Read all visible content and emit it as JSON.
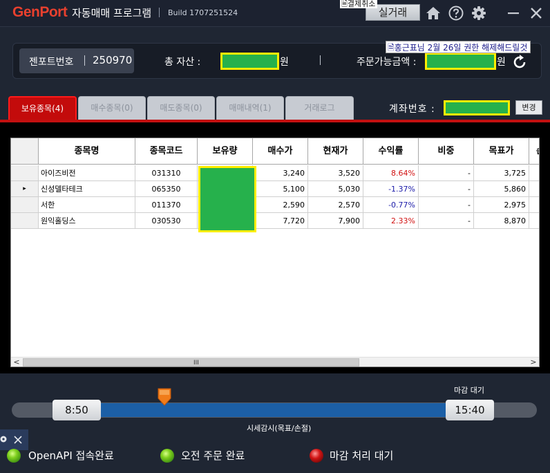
{
  "titlebar": {
    "logo": "GenPort",
    "app_title": "자동매매 프로그램",
    "build": "Build 1707251524",
    "top_notice": "결제취소",
    "live_button": "실거래",
    "icons": [
      "home-icon",
      "help-icon",
      "gear-icon",
      "minimize-icon",
      "close-icon"
    ]
  },
  "info": {
    "genport_label": "젠포트번호",
    "genport_number": "250970",
    "total_assets_label": "총 자산 :",
    "currency": "원",
    "available_label": "주문가능금액 :",
    "notice": "홍근표님 2월 26일 권한 해제해드릴것"
  },
  "tabs": [
    {
      "label": "보유종목(4)",
      "active": true
    },
    {
      "label": "매수종목(0)",
      "active": false
    },
    {
      "label": "매도종목(0)",
      "active": false
    },
    {
      "label": "매매내역(1)",
      "active": false
    },
    {
      "label": "거래로그",
      "active": false
    }
  ],
  "account": {
    "label": "계좌번호 :",
    "change_button": "변경"
  },
  "table": {
    "headers": [
      "종목명",
      "종목코드",
      "보유량",
      "매수가",
      "현재가",
      "수익률",
      "비중",
      "목표가",
      "손"
    ],
    "rows": [
      {
        "name": "아이즈비전",
        "code": "031310",
        "buy": "3,240",
        "current": "3,520",
        "return": "8.64%",
        "weight": "-",
        "target": "3,725",
        "selected": false
      },
      {
        "name": "신성델타테크",
        "code": "065350",
        "buy": "5,100",
        "current": "5,030",
        "return": "-1.37%",
        "weight": "-",
        "target": "5,860",
        "selected": true
      },
      {
        "name": "서한",
        "code": "011370",
        "buy": "2,590",
        "current": "2,570",
        "return": "-0.77%",
        "weight": "-",
        "target": "2,975",
        "selected": false
      },
      {
        "name": "원익홀딩스",
        "code": "030530",
        "buy": "7,720",
        "current": "7,900",
        "return": "2.33%",
        "weight": "-",
        "target": "8,870",
        "selected": false
      }
    ],
    "scroll_left": "<",
    "scroll_right": ">",
    "scroll_grip": "III",
    "row_marker": "▸"
  },
  "timeline": {
    "start": "8:50",
    "end": "15:40",
    "closing_label": "마감 대기",
    "monitor_label": "시세감시(목표/손절)",
    "progress_marker_fraction": 0.19
  },
  "status": [
    {
      "label": "OpenAPI 접속완료",
      "state": "green"
    },
    {
      "label": "오전 주문 완료",
      "state": "green"
    },
    {
      "label": "마감 처리 대기",
      "state": "red"
    }
  ],
  "colors": {
    "brand": "#e8402e",
    "active_tab": "#c30b0b",
    "masked_value": "#26b14c",
    "mask_border": "#ffee00",
    "timeline_fill": "#1c5fa6"
  }
}
